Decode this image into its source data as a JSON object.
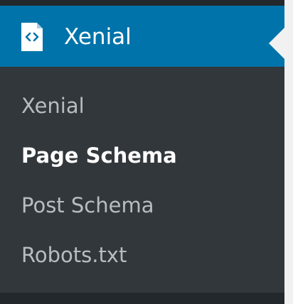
{
  "menu": {
    "title": "Xenial",
    "icon": "code-file-icon",
    "colors": {
      "header_bg": "#0073aa",
      "submenu_bg": "#32373c",
      "sidebar_bg": "#23282d",
      "arrow": "#f1f1f1"
    }
  },
  "submenu": {
    "items": [
      {
        "label": "Xenial",
        "current": false
      },
      {
        "label": "Page Schema",
        "current": true
      },
      {
        "label": "Post Schema",
        "current": false
      },
      {
        "label": "Robots.txt",
        "current": false
      }
    ]
  }
}
